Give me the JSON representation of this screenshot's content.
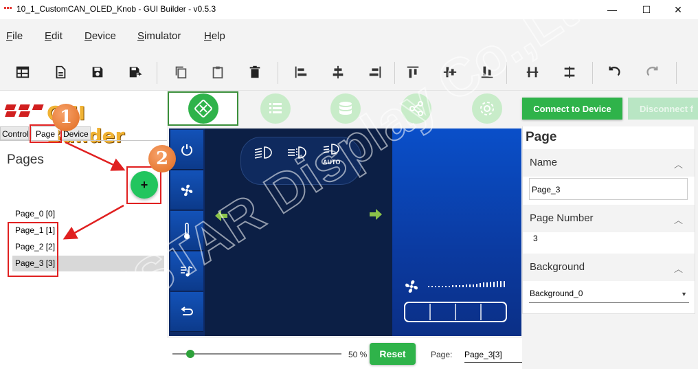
{
  "window": {
    "title": "10_1_CustomCAN_OLED_Knob - GUI Builder - v0.5.3",
    "minimize_glyph": "—",
    "maximize_glyph": "☐",
    "close_glyph": "✕"
  },
  "menu": [
    "File",
    "Edit",
    "Device",
    "Simulator",
    "Help"
  ],
  "toolbar_icons": [
    "new-layout-icon",
    "new-file-icon",
    "save-icon",
    "save-as-icon",
    "copy-icon",
    "paste-icon",
    "delete-icon",
    "align-left-icon",
    "align-center-icon",
    "align-right-icon",
    "align-top-icon",
    "align-middle-icon",
    "align-bottom-icon",
    "distribute-horizontal-icon",
    "distribute-vertical-icon",
    "undo-icon",
    "redo-icon"
  ],
  "logo": {
    "text": "GUI Builder"
  },
  "left_tabs": [
    "Control",
    "Page",
    "Device"
  ],
  "pages_panel": {
    "title": "Pages",
    "add_button": "+",
    "pages": [
      "Page_0 [0]",
      "Page_1 [1]",
      "Page_2 [2]",
      "Page_3 [3]"
    ],
    "selected_index": 3
  },
  "center_tabs": [
    "widgets-icon",
    "list-icon",
    "database-icon",
    "share-icon",
    "settings-icon"
  ],
  "preview": {
    "light_labels": [
      "AUTO"
    ]
  },
  "device": {
    "connect_label": "Connect to Device",
    "disconnect_label": "Disconnect f"
  },
  "properties": {
    "title": "Page",
    "name_label": "Name",
    "name_value": "Page_3",
    "page_number_label": "Page Number",
    "page_number_value": "3",
    "background_label": "Background",
    "background_value": "Background_0"
  },
  "bottom": {
    "zoom_label": "50 %",
    "zoom_fraction": 0.5,
    "reset_label": "Reset",
    "page_label": "Page:",
    "page_value": "Page_3[3]"
  },
  "annotations": {
    "badge_1": "1",
    "badge_2": "2"
  },
  "watermark": "WINSTAR Display Co.,Ltd.",
  "colors": {
    "accent_green": "#2fb34a",
    "callout_red": "#e02020",
    "badge_orange": "#e06a1f"
  }
}
